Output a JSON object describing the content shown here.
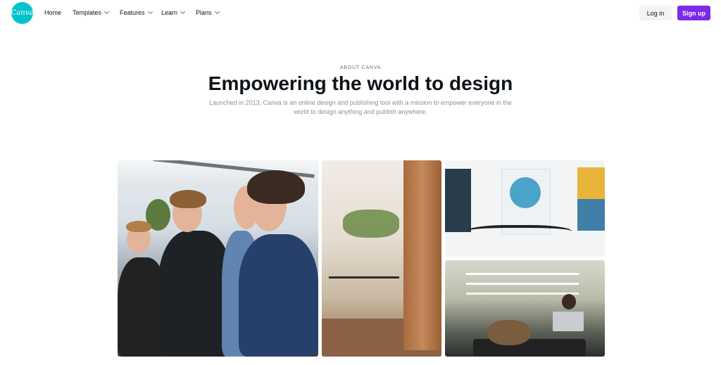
{
  "nav": {
    "logo_text": "Canva",
    "items": [
      {
        "label": "Home",
        "has_dropdown": false
      },
      {
        "label": "Templates",
        "has_dropdown": true
      },
      {
        "label": "Features",
        "has_dropdown": true
      },
      {
        "label": "Learn",
        "has_dropdown": true
      },
      {
        "label": "Plans",
        "has_dropdown": true
      }
    ],
    "login_label": "Log in",
    "signup_label": "Sign up",
    "signup_color": "#7d2ae8",
    "logo_color": "#00c4cc"
  },
  "hero": {
    "eyebrow": "ABOUT CANVA",
    "title": "Empowering the world to design",
    "subtitle": "Launched in 2013, Canva is an online design and publishing tool with a mission to empower everyone in the world to design anything and publish anywhere."
  },
  "gallery": {
    "photos": [
      {
        "name": "team-photo"
      },
      {
        "name": "office-interior-photo"
      },
      {
        "name": "wall-art-photo"
      },
      {
        "name": "office-workspace-photo"
      }
    ]
  }
}
